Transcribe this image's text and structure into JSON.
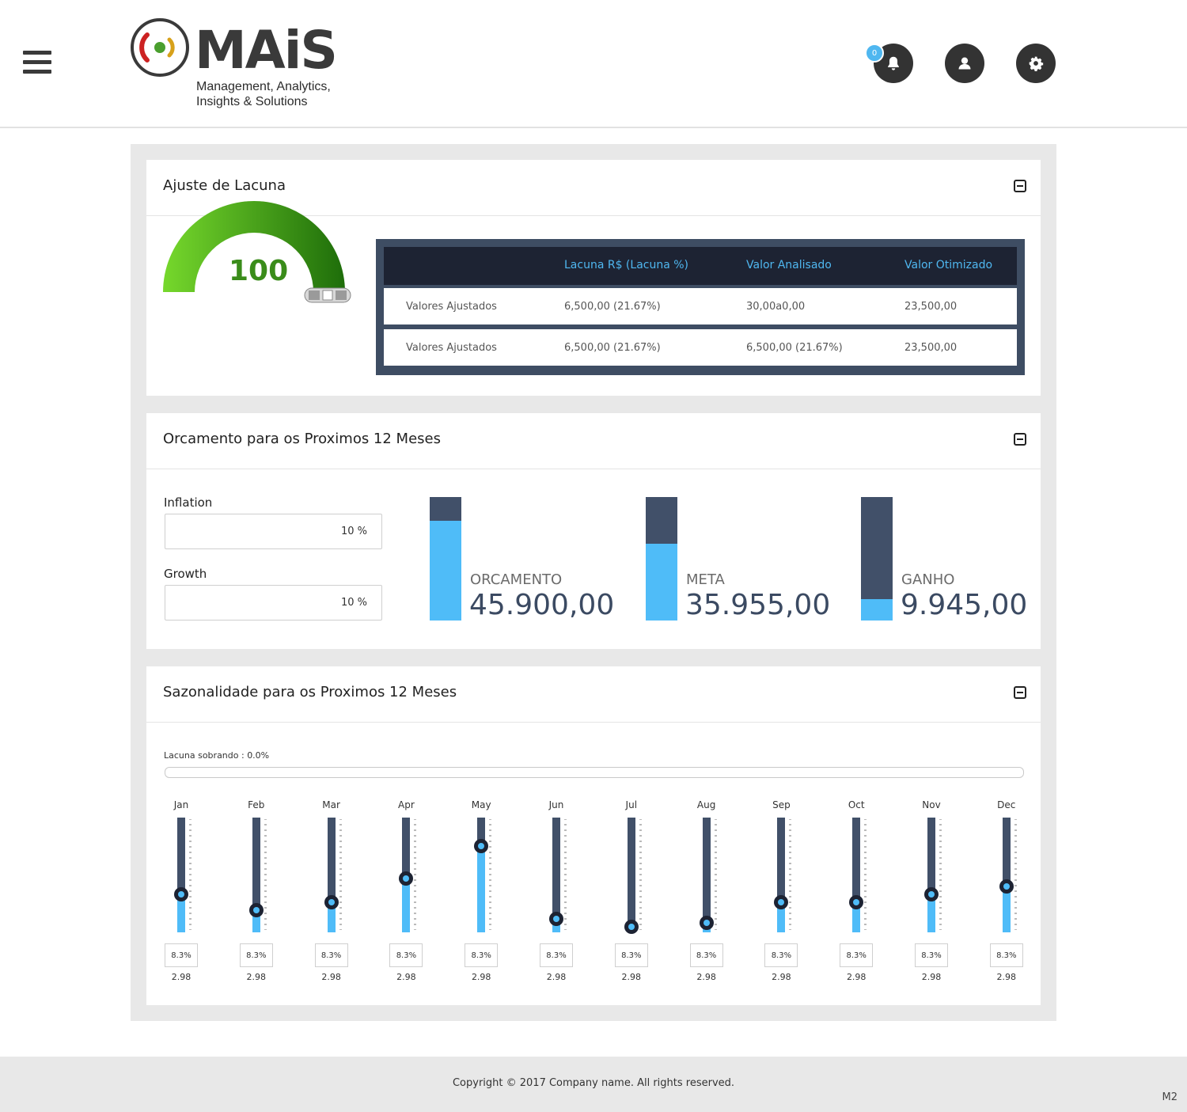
{
  "header": {
    "logo": {
      "word": "MAiS",
      "sub_line1": "Management, Analytics,",
      "sub_line2": "Insights & Solutions"
    },
    "notification_count": "0",
    "colors": {
      "button_bg": "#333333",
      "badge": "#4fb7f0"
    },
    "icons": [
      "menu-icon",
      "bell-icon",
      "user-icon",
      "gear-icon"
    ]
  },
  "ajuste": {
    "title": "Ajuste de Lacuna",
    "gauge_value": "100",
    "gauge_level": 1.0,
    "columns": [
      "",
      "Lacuna R$ (Lacuna %)",
      "Valor Analisado",
      "Valor Otimizado"
    ],
    "rows": [
      [
        "Valores Ajustados",
        "6,500,00 (21.67%)",
        "30,00a0,00",
        "23,500,00"
      ],
      [
        "Valores Ajustados",
        "6,500,00 (21.67%)",
        "6,500,00 (21.67%)",
        "23,500,00"
      ]
    ]
  },
  "orcamento": {
    "title": "Orcamento para os Proximos 12 Meses",
    "inflation": {
      "label": "Inflation",
      "value": "10  %"
    },
    "growth": {
      "label": "Growth",
      "value": "10  %"
    },
    "kpis": [
      {
        "label": "ORCAMENTO",
        "value": "45.900,00",
        "fill": 0.81
      },
      {
        "label": "META",
        "value": "35.955,00",
        "fill": 0.62
      },
      {
        "label": "GANHO",
        "value": "9.945,00",
        "fill": 0.17
      }
    ],
    "colors": {
      "dark": "#415069",
      "accent": "#4fbcf8",
      "value_text": "#3b4a62"
    }
  },
  "sazonalidade": {
    "title": "Sazonalidade para os Proximos 12 Meses",
    "lacuna_label": "Lacuna sobrando : 0.0%",
    "months": [
      {
        "name": "Jan",
        "pct": "8.3%",
        "value": "2.98",
        "level": 0.33
      },
      {
        "name": "Feb",
        "pct": "8.3%",
        "value": "2.98",
        "level": 0.19
      },
      {
        "name": "Mar",
        "pct": "8.3%",
        "value": "2.98",
        "level": 0.26
      },
      {
        "name": "Apr",
        "pct": "8.3%",
        "value": "2.98",
        "level": 0.47
      },
      {
        "name": "May",
        "pct": "8.3%",
        "value": "2.98",
        "level": 0.75
      },
      {
        "name": "Jun",
        "pct": "8.3%",
        "value": "2.98",
        "level": 0.12
      },
      {
        "name": "Jul",
        "pct": "8.3%",
        "value": "2.98",
        "level": 0.05
      },
      {
        "name": "Aug",
        "pct": "8.3%",
        "value": "2.98",
        "level": 0.08
      },
      {
        "name": "Sep",
        "pct": "8.3%",
        "value": "2.98",
        "level": 0.26
      },
      {
        "name": "Oct",
        "pct": "8.3%",
        "value": "2.98",
        "level": 0.26
      },
      {
        "name": "Nov",
        "pct": "8.3%",
        "value": "2.98",
        "level": 0.33
      },
      {
        "name": "Dec",
        "pct": "8.3%",
        "value": "2.98",
        "level": 0.4
      }
    ]
  },
  "footer": {
    "copyright": "Copyright  ©  2017  Company name.  All rights reserved.",
    "mark": "M2"
  }
}
